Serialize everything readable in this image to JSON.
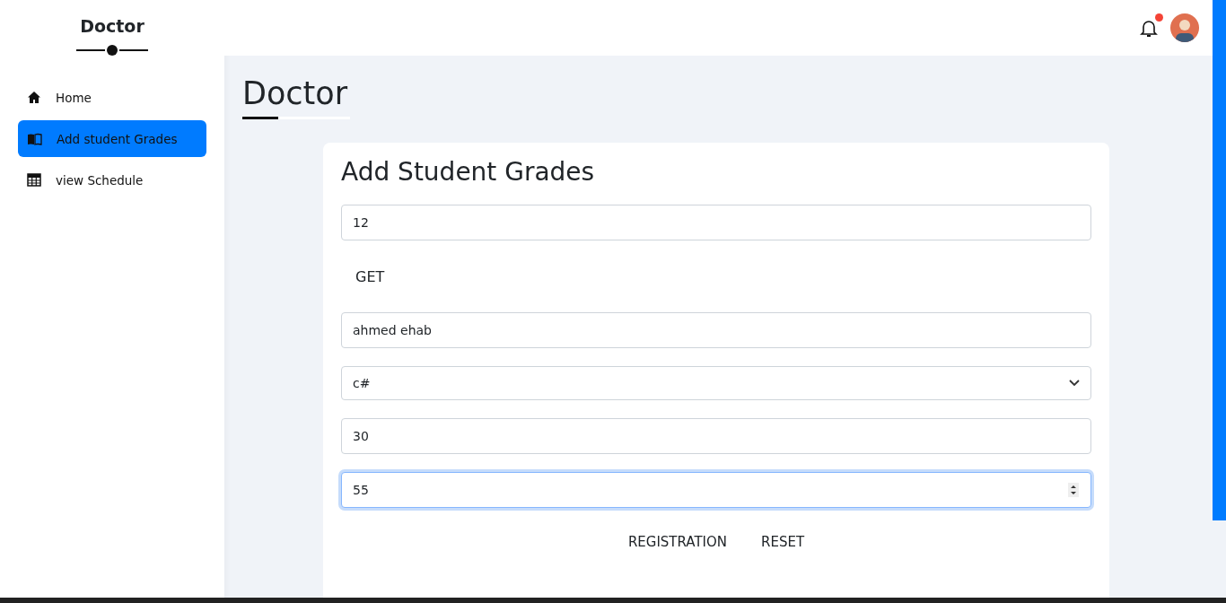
{
  "sidebar": {
    "title": "Doctor",
    "items": [
      {
        "label": "Home",
        "selected": false
      },
      {
        "label": "Add student Grades",
        "selected": true
      },
      {
        "label": "view Schedule",
        "selected": false
      }
    ]
  },
  "header": {
    "has_notification": true
  },
  "page_title": "Doctor",
  "form": {
    "title": "Add Student Grades",
    "fields": [
      {
        "kind": "text",
        "value": "12",
        "focused": false
      },
      {
        "kind": "button",
        "label": "GET"
      },
      {
        "kind": "text",
        "value": "ahmed ehab",
        "focused": false
      },
      {
        "kind": "select",
        "value": "c#"
      },
      {
        "kind": "text",
        "value": "30",
        "focused": false
      },
      {
        "kind": "number",
        "value": "55",
        "focused": true
      }
    ],
    "buttons": [
      "REGISTRATION",
      "RESET"
    ]
  }
}
